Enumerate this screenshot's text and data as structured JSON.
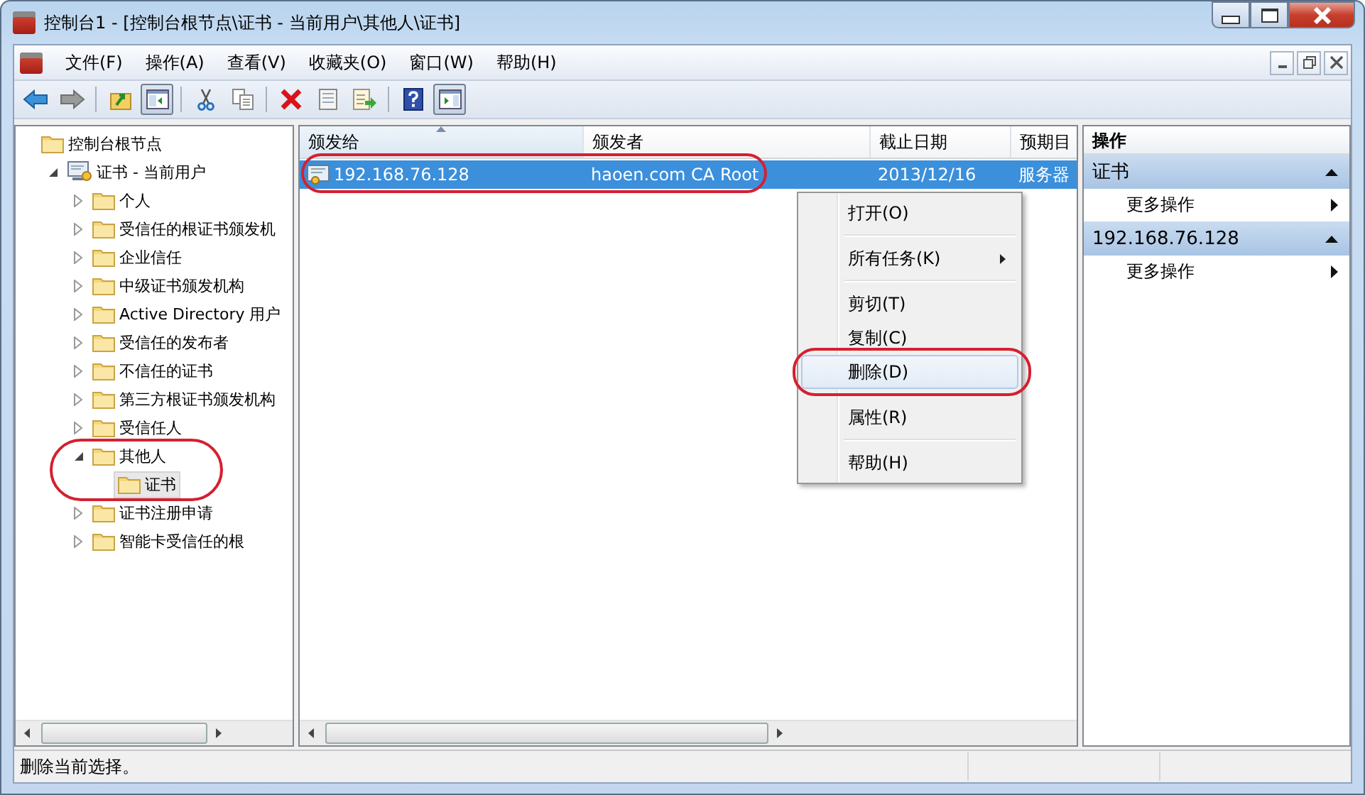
{
  "window": {
    "title": "控制台1 - [控制台根节点\\证书 - 当前用户\\其他人\\证书]"
  },
  "menu_bar": [
    {
      "label": "文件(F)"
    },
    {
      "label": "操作(A)"
    },
    {
      "label": "查看(V)"
    },
    {
      "label": "收藏夹(O)"
    },
    {
      "label": "窗口(W)"
    },
    {
      "label": "帮助(H)"
    }
  ],
  "toolbar": [
    {
      "kind": "back",
      "pressed": false
    },
    {
      "kind": "forward",
      "pressed": false
    },
    {
      "kind": "sep"
    },
    {
      "kind": "up",
      "pressed": false
    },
    {
      "kind": "tree",
      "pressed": true
    },
    {
      "kind": "sep"
    },
    {
      "kind": "cut",
      "pressed": false
    },
    {
      "kind": "copy",
      "pressed": false
    },
    {
      "kind": "sep"
    },
    {
      "kind": "delete",
      "pressed": false
    },
    {
      "kind": "properties",
      "pressed": false
    },
    {
      "kind": "export",
      "pressed": false
    },
    {
      "kind": "sep"
    },
    {
      "kind": "help",
      "pressed": false
    },
    {
      "kind": "actions",
      "pressed": true
    }
  ],
  "tree": [
    {
      "label": "控制台根节点",
      "kind": "folder",
      "selected": false,
      "circled": false,
      "children": [
        {
          "label": "证书 - 当前用户",
          "kind": "store",
          "expanded": true,
          "selected": false,
          "circled": false,
          "children": [
            {
              "label": "个人",
              "kind": "folder",
              "expanded": false,
              "selected": false,
              "circled": false
            },
            {
              "label": "受信任的根证书颁发机",
              "kind": "folder",
              "expanded": false,
              "selected": false,
              "circled": false
            },
            {
              "label": "企业信任",
              "kind": "folder",
              "expanded": false,
              "selected": false,
              "circled": false
            },
            {
              "label": "中级证书颁发机构",
              "kind": "folder",
              "expanded": false,
              "selected": false,
              "circled": false
            },
            {
              "label": "Active Directory 用户",
              "kind": "folder",
              "expanded": false,
              "selected": false,
              "circled": false
            },
            {
              "label": "受信任的发布者",
              "kind": "folder",
              "expanded": false,
              "selected": false,
              "circled": false
            },
            {
              "label": "不信任的证书",
              "kind": "folder",
              "expanded": false,
              "selected": false,
              "circled": false
            },
            {
              "label": "第三方根证书颁发机构",
              "kind": "folder",
              "expanded": false,
              "selected": false,
              "circled": false
            },
            {
              "label": "受信任人",
              "kind": "folder",
              "expanded": false,
              "selected": false,
              "circled": false
            },
            {
              "label": "其他人",
              "kind": "folder",
              "expanded": true,
              "selected": false,
              "circled": true,
              "children": [
                {
                  "label": "证书",
                  "kind": "folder",
                  "selected": true,
                  "circled": false
                }
              ]
            },
            {
              "label": "证书注册申请",
              "kind": "folder",
              "expanded": false,
              "selected": false,
              "circled": false
            },
            {
              "label": "智能卡受信任的根",
              "kind": "folder",
              "expanded": false,
              "selected": false,
              "circled": false
            }
          ]
        }
      ]
    }
  ],
  "table": {
    "columns": [
      {
        "label": "颁发给",
        "sorted": true
      },
      {
        "label": "颁发者",
        "sorted": false
      },
      {
        "label": "截止日期",
        "sorted": false
      },
      {
        "label": "预期目",
        "sorted": false
      }
    ],
    "rows": [
      {
        "cells": [
          "192.168.76.128",
          "haoen.com CA Root",
          "2013/12/16",
          "服务器"
        ],
        "selected": true,
        "circled": true
      }
    ]
  },
  "context_menu": [
    {
      "kind": "item",
      "label": "打开(O)",
      "selected": false,
      "circled": false
    },
    {
      "kind": "sep"
    },
    {
      "kind": "submenu",
      "label": "所有任务(K)",
      "selected": false,
      "circled": false
    },
    {
      "kind": "sep"
    },
    {
      "kind": "item",
      "label": "剪切(T)",
      "selected": false,
      "circled": false
    },
    {
      "kind": "item",
      "label": "复制(C)",
      "selected": false,
      "circled": false
    },
    {
      "kind": "item",
      "label": "删除(D)",
      "selected": true,
      "circled": true
    },
    {
      "kind": "sep"
    },
    {
      "kind": "item",
      "label": "属性(R)",
      "selected": false,
      "circled": false
    },
    {
      "kind": "sep"
    },
    {
      "kind": "item",
      "label": "帮助(H)",
      "selected": false,
      "circled": false
    }
  ],
  "actions": {
    "title": "操作",
    "sections": [
      {
        "title": "证书",
        "expanded": true,
        "items": [
          "更多操作"
        ]
      },
      {
        "title": "192.168.76.128",
        "expanded": true,
        "items": [
          "更多操作"
        ]
      }
    ]
  },
  "status_bar": {
    "text": "删除当前选择。"
  }
}
